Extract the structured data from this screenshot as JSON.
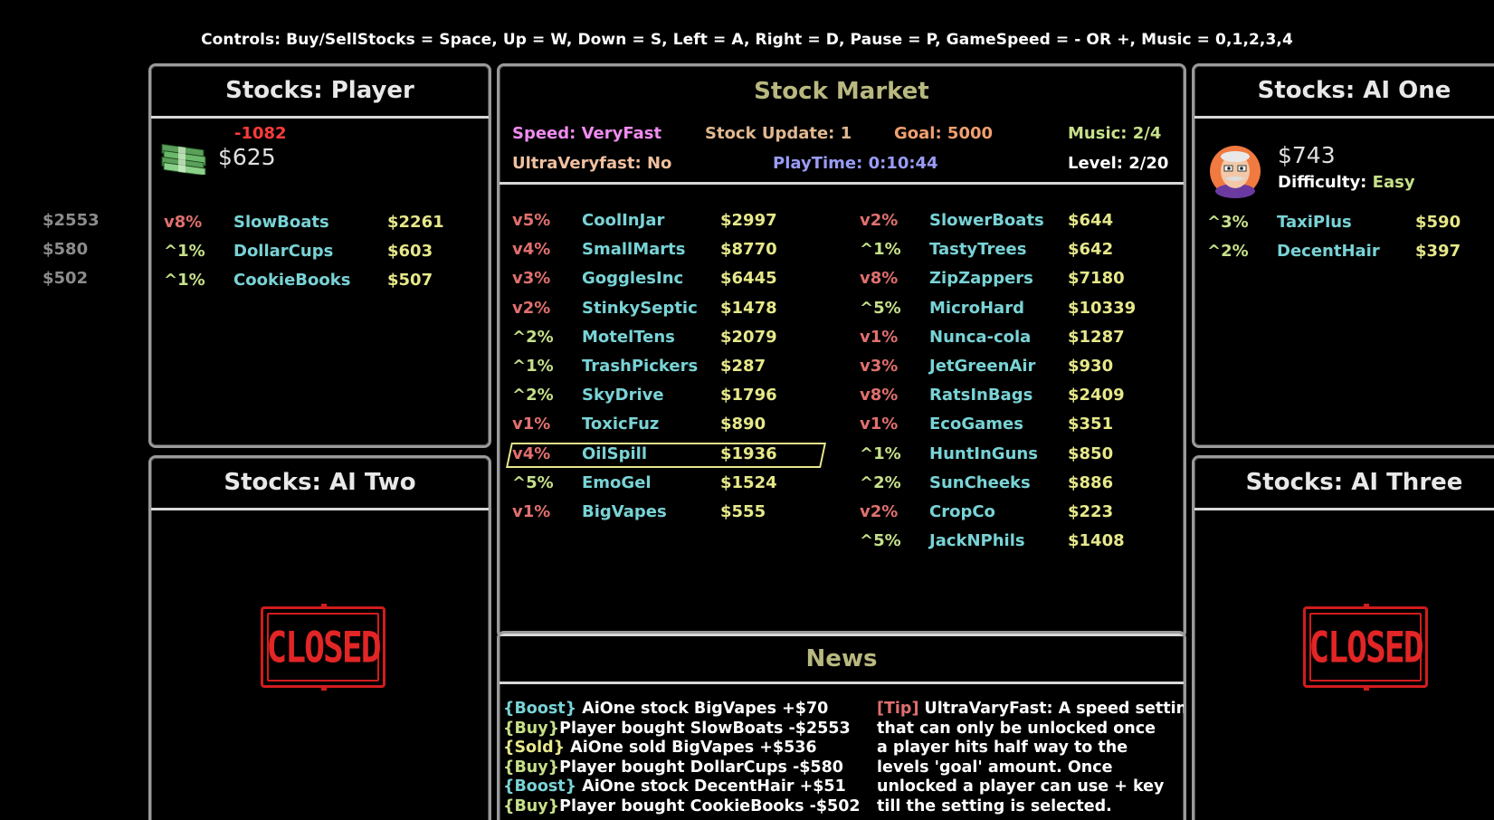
{
  "controls": "Controls: Buy/SellStocks = Space, Up = W, Down = S, Left = A, Right = D, Pause = P, GameSpeed = - OR +, Music = 0,1,2,3,4",
  "left_prices": [
    "$2553",
    "$580",
    "$502"
  ],
  "player": {
    "title": "Stocks: Player",
    "change": "-1082",
    "money": "$625",
    "icon": "money-stack-icon",
    "stocks": [
      {
        "change": "v8%",
        "dir": "down",
        "name": "SlowBoats",
        "price": "$2261"
      },
      {
        "change": "^1%",
        "dir": "up",
        "name": "DollarCups",
        "price": "$603"
      },
      {
        "change": "^1%",
        "dir": "up",
        "name": "CookieBooks",
        "price": "$507"
      }
    ]
  },
  "market": {
    "title": "Stock Market",
    "speed": "Speed: VeryFast",
    "stock_update": "Stock Update: 1",
    "goal": "Goal: 5000",
    "music": "Music: 2/4",
    "ultra": "UltraVeryfast: No",
    "playtime": "PlayTime: 0:10:44",
    "level": "Level: 2/20",
    "colors": {
      "speed": "#f08cf0",
      "stock_update": "#e0b890",
      "goal": "#f0a070",
      "music": "#c6e08a",
      "ultra": "#f0c0a0",
      "playtime": "#9a9cf6",
      "level": "#ffffff"
    },
    "left_col": [
      {
        "change": "v5%",
        "dir": "down",
        "name": "CoolInJar",
        "price": "$2997"
      },
      {
        "change": "v4%",
        "dir": "down",
        "name": "SmallMarts",
        "price": "$8770"
      },
      {
        "change": "v3%",
        "dir": "down",
        "name": "GogglesInc",
        "price": "$6445"
      },
      {
        "change": "v2%",
        "dir": "down",
        "name": "StinkySeptic",
        "price": "$1478"
      },
      {
        "change": "^2%",
        "dir": "up",
        "name": "MotelTens",
        "price": "$2079"
      },
      {
        "change": "^1%",
        "dir": "up",
        "name": "TrashPickers",
        "price": "$287"
      },
      {
        "change": "^2%",
        "dir": "up",
        "name": "SkyDrive",
        "price": "$1796"
      },
      {
        "change": "v1%",
        "dir": "down",
        "name": "ToxicFuz",
        "price": "$890"
      },
      {
        "change": "v4%",
        "dir": "down",
        "name": "OilSpill",
        "price": "$1936"
      },
      {
        "change": "^5%",
        "dir": "up",
        "name": "EmoGel",
        "price": "$1524"
      },
      {
        "change": "v1%",
        "dir": "down",
        "name": "BigVapes",
        "price": "$555"
      }
    ],
    "right_col": [
      {
        "change": "v2%",
        "dir": "down",
        "name": "SlowerBoats",
        "price": "$644"
      },
      {
        "change": "^1%",
        "dir": "up",
        "name": "TastyTrees",
        "price": "$642"
      },
      {
        "change": "v8%",
        "dir": "down",
        "name": "ZipZappers",
        "price": "$7180"
      },
      {
        "change": "^5%",
        "dir": "up",
        "name": "MicroHard",
        "price": "$10339"
      },
      {
        "change": "v1%",
        "dir": "down",
        "name": "Nunca-cola",
        "price": "$1287"
      },
      {
        "change": "v3%",
        "dir": "down",
        "name": "JetGreenAir",
        "price": "$930"
      },
      {
        "change": "v8%",
        "dir": "down",
        "name": "RatsInBags",
        "price": "$2409"
      },
      {
        "change": "v1%",
        "dir": "down",
        "name": "EcoGames",
        "price": "$351"
      },
      {
        "change": "^1%",
        "dir": "up",
        "name": "HuntInGuns",
        "price": "$850"
      },
      {
        "change": "^2%",
        "dir": "up",
        "name": "SunCheeks",
        "price": "$886"
      },
      {
        "change": "v2%",
        "dir": "down",
        "name": "CropCo",
        "price": "$223"
      },
      {
        "change": "^5%",
        "dir": "up",
        "name": "JackNPhils",
        "price": "$1408"
      }
    ],
    "selected_index": 8
  },
  "news": {
    "title": "News",
    "items": [
      {
        "tag": "{Boost}",
        "kind": "boost",
        "text": " AiOne stock BigVapes +$70"
      },
      {
        "tag": "{Buy}",
        "kind": "buy",
        "text": "Player bought SlowBoats -$2553"
      },
      {
        "tag": "{Sold}",
        "kind": "sold",
        "text": " AiOne sold BigVapes +$536"
      },
      {
        "tag": "{Buy}",
        "kind": "buy",
        "text": "Player bought DollarCups -$580"
      },
      {
        "tag": "{Boost}",
        "kind": "boost",
        "text": " AiOne stock DecentHair +$51"
      },
      {
        "tag": "{Buy}",
        "kind": "buy",
        "text": "Player bought CookieBooks -$502"
      }
    ],
    "tip_tag": "[Tip]",
    "tip_lines": [
      " UltraVaryFast: A speed setting",
      "that can only be unlocked once",
      "a player hits half way to the",
      "levels 'goal' amount. Once",
      "unlocked a player can use + key",
      "till the setting is selected."
    ]
  },
  "ai_one": {
    "title": "Stocks: AI One",
    "money": "$743",
    "difficulty_label": "Difficulty: ",
    "difficulty": "Easy",
    "icon": "ai-one-avatar-icon",
    "stocks": [
      {
        "change": "^3%",
        "dir": "up",
        "name": "TaxiPlus",
        "price": "$590"
      },
      {
        "change": "^2%",
        "dir": "up",
        "name": "DecentHair",
        "price": "$397"
      }
    ]
  },
  "ai_two": {
    "title": "Stocks: AI Two",
    "sign": "CLOSED"
  },
  "ai_three": {
    "title": "Stocks: AI Three",
    "sign": "CLOSED"
  }
}
